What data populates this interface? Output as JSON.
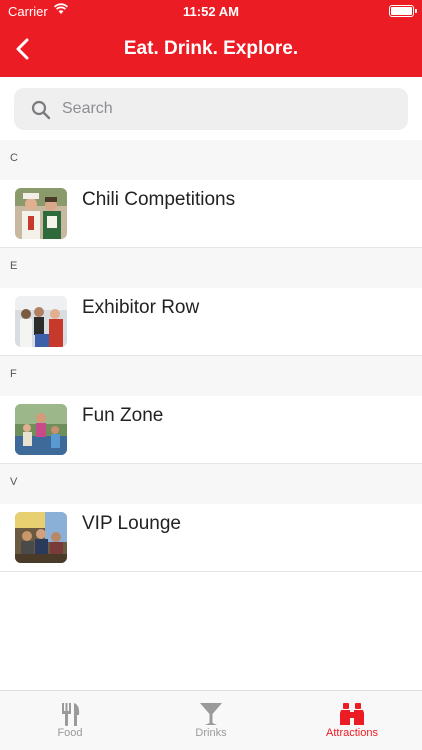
{
  "status_bar": {
    "carrier": "Carrier",
    "time": "11:52 AM"
  },
  "header": {
    "title": "Eat. Drink. Explore."
  },
  "search": {
    "placeholder": "Search"
  },
  "sections": [
    {
      "letter": "C",
      "item": "Chili Competitions"
    },
    {
      "letter": "E",
      "item": "Exhibitor Row"
    },
    {
      "letter": "F",
      "item": "Fun Zone"
    },
    {
      "letter": "V",
      "item": "VIP Lounge"
    }
  ],
  "tabs": [
    {
      "label": "Food",
      "icon": "fork-knife-icon",
      "active": false
    },
    {
      "label": "Drinks",
      "icon": "martini-glass-icon",
      "active": false
    },
    {
      "label": "Attractions",
      "icon": "binoculars-icon",
      "active": true
    }
  ],
  "colors": {
    "brand_red": "#ec1c24",
    "inactive_tab": "#9a9a9a",
    "section_bg": "#f7f7f8"
  }
}
